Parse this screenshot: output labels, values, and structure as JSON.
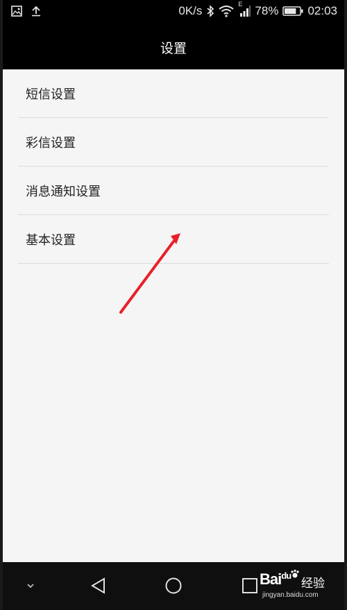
{
  "status_bar": {
    "left_icons": [
      "image-icon",
      "upload-icon"
    ],
    "speed": "0K/s",
    "network_type": "E",
    "battery_percent": "78%",
    "battery_level": 0.78,
    "time": "02:03"
  },
  "header": {
    "title": "设置"
  },
  "settings": {
    "items": [
      {
        "label": "短信设置"
      },
      {
        "label": "彩信设置"
      },
      {
        "label": "消息通知设置"
      },
      {
        "label": "基本设置"
      }
    ]
  },
  "annotation": {
    "arrow_color": "#e8202a"
  },
  "nav_bar": {
    "buttons": [
      "chevron-down-icon",
      "back-icon",
      "home-icon",
      "recents-icon"
    ]
  },
  "watermark": {
    "brand": "Bai",
    "brand2": "du",
    "product": "经验",
    "url": "jingyan.baidu.com"
  },
  "colors": {
    "background": "#f5f5f5",
    "bars": "#000000",
    "divider": "#dcdcdc"
  }
}
